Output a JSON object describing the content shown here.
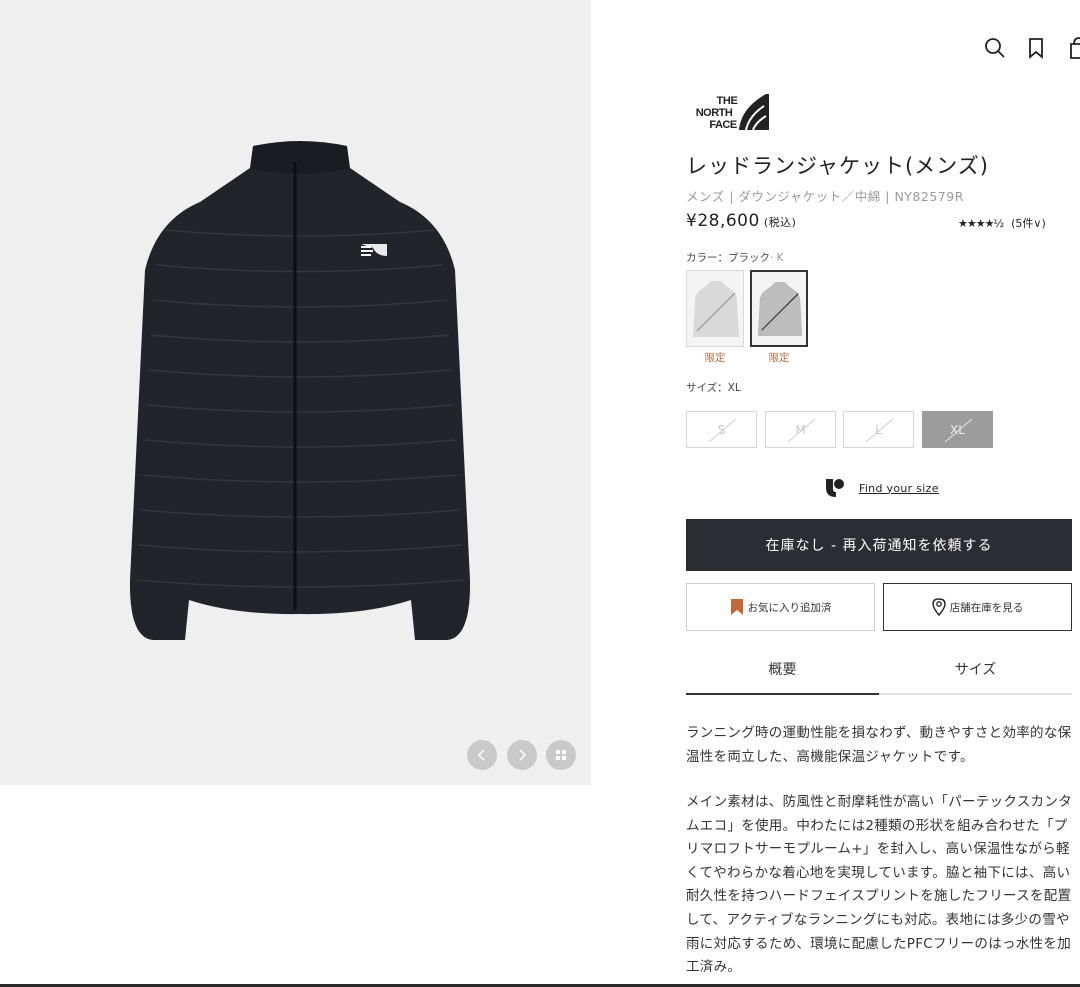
{
  "header": {
    "icons": [
      "search-icon",
      "bookmark-icon",
      "cart-icon"
    ]
  },
  "brand": {
    "logo_text": "THE NORTH FACE"
  },
  "product": {
    "title": "レッドランジャケット(メンズ)",
    "breadcrumb": "メンズ | ダウンジャケット／中綿 | NY82579R",
    "price": "¥28,600",
    "tax_note": "(税込)",
    "stars": "★★★★½",
    "review_count": "(5件∨)"
  },
  "color": {
    "label": "カラー：ブラック",
    "code": "· K",
    "swatches": [
      {
        "tag": "限定",
        "shade": "#d6d6d6",
        "selected": false
      },
      {
        "tag": "限定",
        "shade": "#b8b8b8",
        "selected": true
      }
    ]
  },
  "size": {
    "label": "サイズ：XL",
    "options": [
      {
        "label": "S",
        "available": false,
        "selected": false
      },
      {
        "label": "M",
        "available": false,
        "selected": false
      },
      {
        "label": "L",
        "available": false,
        "selected": false
      },
      {
        "label": "XL",
        "available": false,
        "selected": true
      }
    ]
  },
  "fit_finder": {
    "label": "Find your size"
  },
  "actions": {
    "restock_label": "在庫なし - 再入荷通知を依頼する",
    "favorite_label": "お気に入り追加済",
    "store_label": "店舗在庫を見る"
  },
  "tabs": [
    {
      "label": "概要",
      "active": true
    },
    {
      "label": "サイズ",
      "active": false
    }
  ],
  "description": [
    "ランニング時の運動性能を損なわず、動きやすさと効率的な保温性を両立した、高機能保温ジャケットです。",
    "メイン素材は、防風性と耐摩耗性が高い「パーテックスカンタムエコ」を使用。中わたには2種類の形状を組み合わせた「プリマロフトサーモプルーム+」を封入し、高い保温性ながら軽くてやわらかな着心地を実現しています。脇と袖下には、高い耐久性を持つハードフェイスプリントを施したフリースを配置して、アクティブなランニングにも対応。表地には多少の雪や雨に対応するため、環境に配慮したPFCフリーのはっ水性を加工済み。"
  ],
  "colors": {
    "cta_bg": "#2c2c33",
    "accent_tag": "#b86a3a",
    "favorite_icon": "#c4683a"
  }
}
